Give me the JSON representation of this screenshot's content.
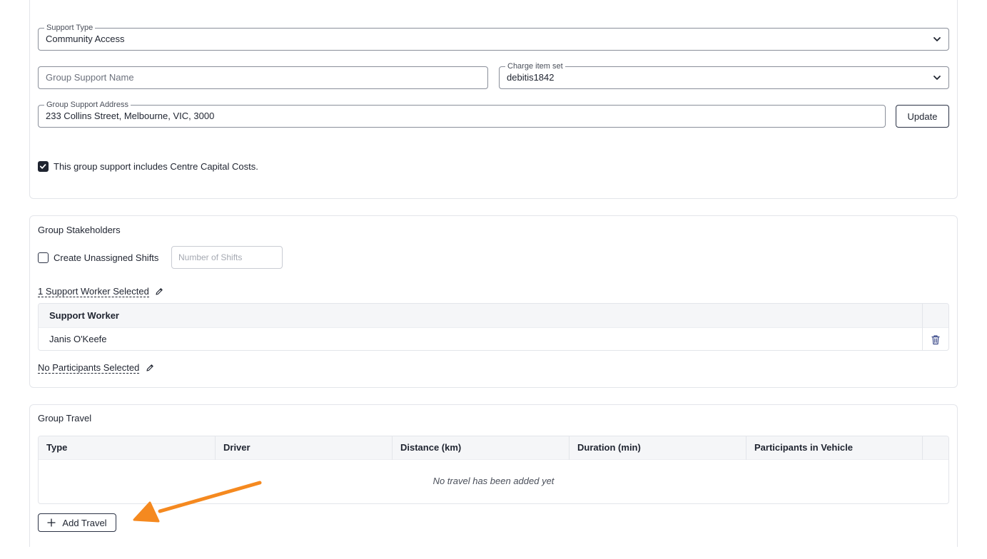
{
  "details": {
    "support_type": {
      "label": "Support Type",
      "value": "Community Access"
    },
    "group_support_name": {
      "placeholder": "Group Support Name"
    },
    "charge_item_set": {
      "label": "Charge item set",
      "value": "debitis1842"
    },
    "address": {
      "label": "Group Support Address",
      "value": "233 Collins Street, Melbourne, VIC, 3000"
    },
    "update_label": "Update",
    "centre_capital_costs": {
      "label": "This group support includes Centre Capital Costs.",
      "checked": true
    }
  },
  "stakeholders": {
    "title": "Group Stakeholders",
    "unassigned_shifts": {
      "label": "Create Unassigned Shifts",
      "checked": false
    },
    "number_of_shifts_placeholder": "Number of Shifts",
    "support_workers_link": "1 Support Worker Selected",
    "support_worker_table": {
      "header": "Support Worker",
      "rows": [
        "Janis O'Keefe"
      ]
    },
    "participants_link": "No Participants Selected"
  },
  "travel": {
    "title": "Group Travel",
    "columns": [
      "Type",
      "Driver",
      "Distance (km)",
      "Duration (min)",
      "Participants in Vehicle"
    ],
    "empty_message": "No travel has been added yet",
    "add_label": "Add Travel"
  },
  "colors": {
    "annotation_arrow": "#f5891f",
    "text": "#1f2430",
    "border": "#e3e5ea"
  },
  "icons": [
    "chevron-down-icon",
    "check-icon",
    "pencil-icon",
    "trash-icon",
    "plus-icon"
  ]
}
